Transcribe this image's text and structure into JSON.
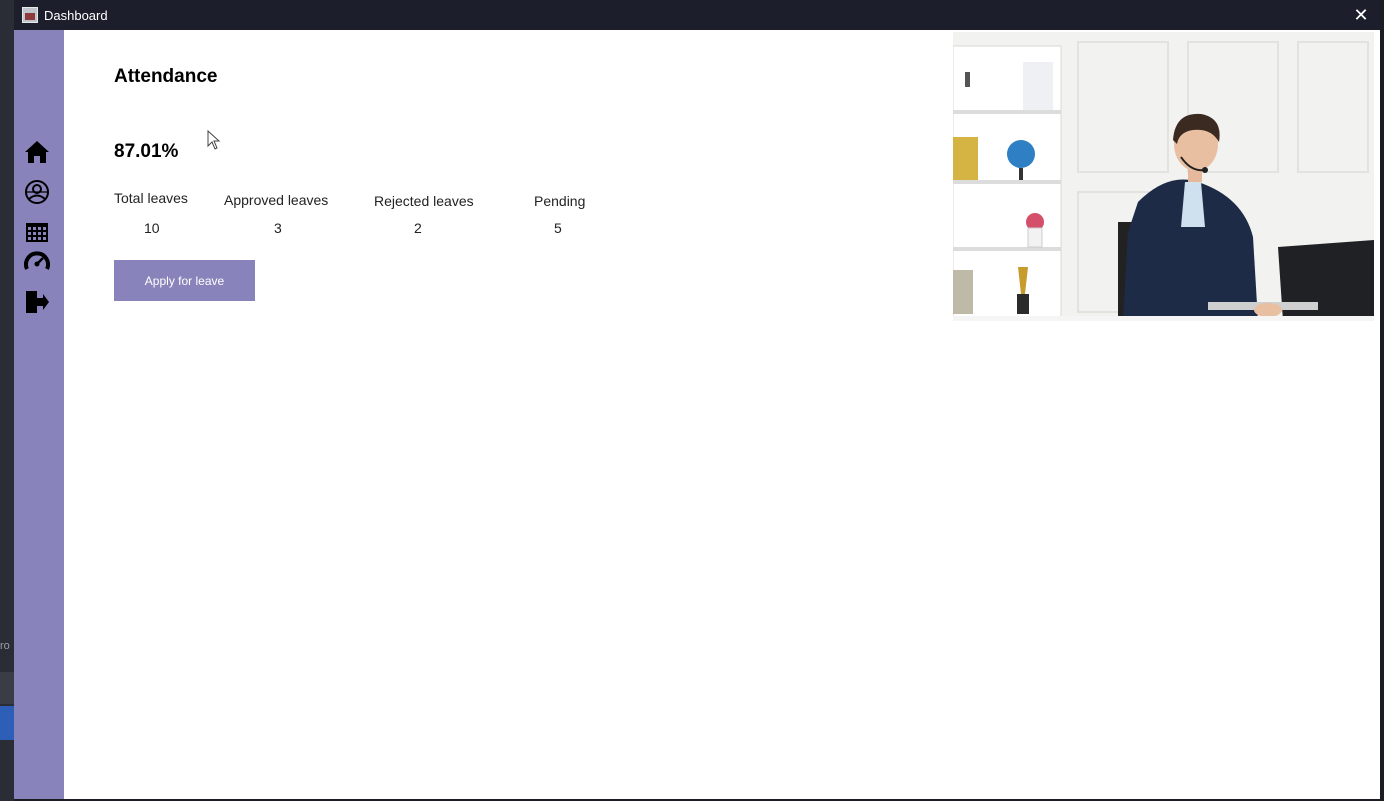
{
  "window": {
    "title": "Dashboard",
    "close_glyph": "✕"
  },
  "sidebar": {
    "items": [
      {
        "icon": "home-icon"
      },
      {
        "icon": "profile-icon"
      },
      {
        "icon": "calendar-icon"
      },
      {
        "icon": "dashboard-gauge-icon"
      },
      {
        "icon": "logout-icon"
      }
    ]
  },
  "attendance": {
    "heading": "Attendance",
    "percentage": "87.01%",
    "stats": [
      {
        "label": "Total leaves",
        "value": "10"
      },
      {
        "label": "Approved leaves",
        "value": "3"
      },
      {
        "label": "Rejected leaves",
        "value": "2"
      },
      {
        "label": "Pending",
        "value": "5"
      }
    ],
    "apply_button": "Apply for leave"
  },
  "colors": {
    "accent": "#8884bb",
    "titlebar": "#1c1f2b"
  }
}
